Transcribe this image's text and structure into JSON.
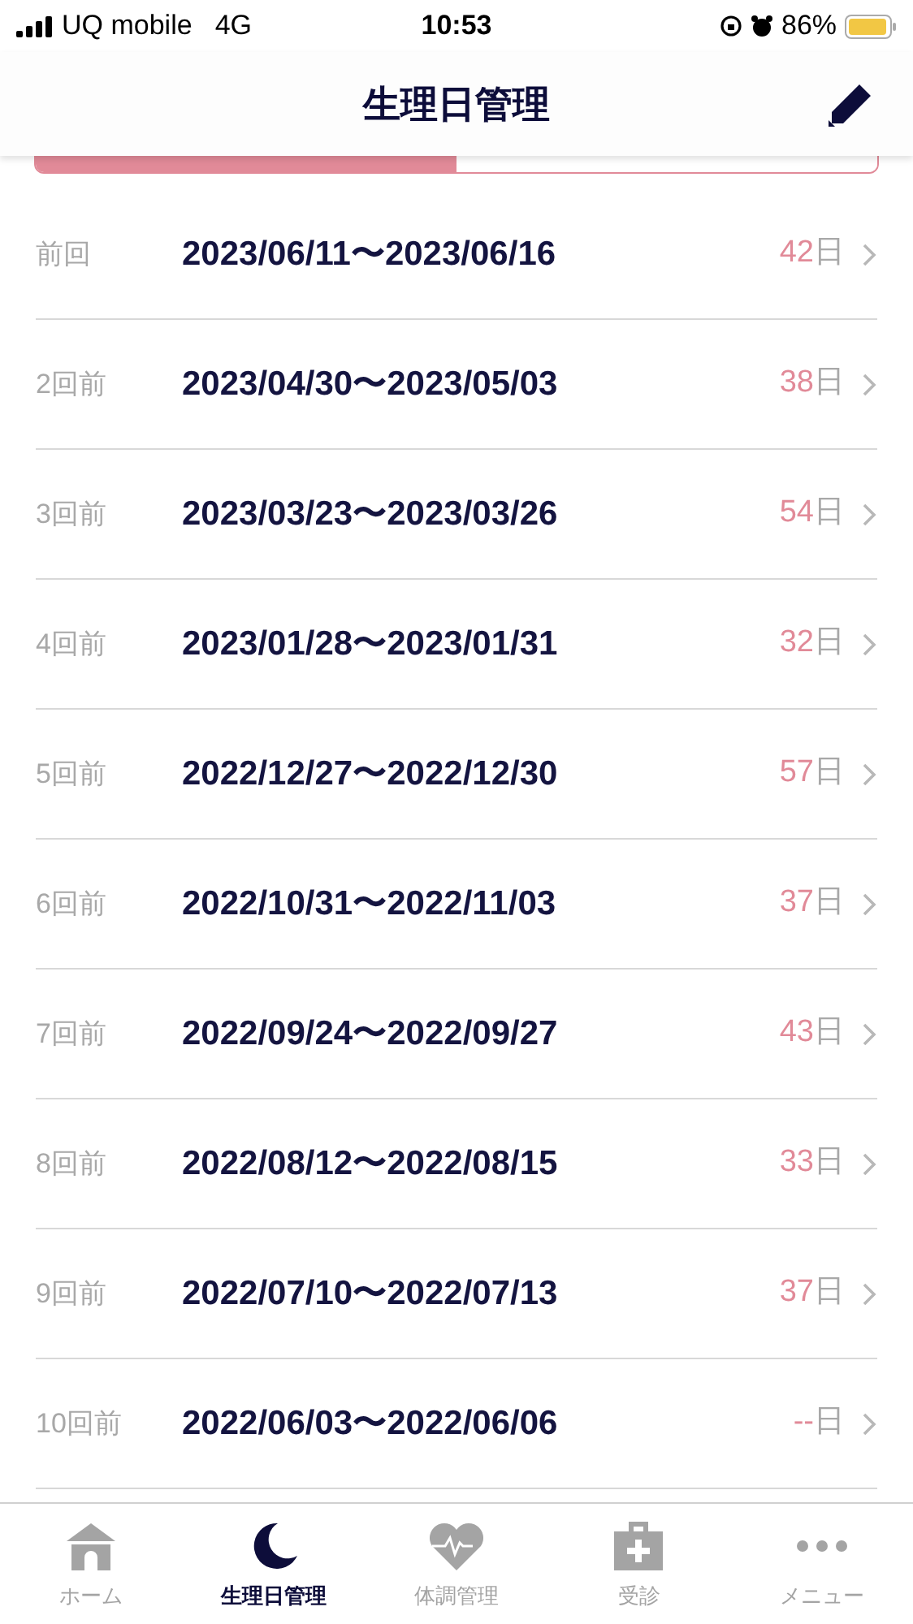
{
  "status_bar": {
    "carrier": "UQ mobile",
    "network": "4G",
    "time": "10:53",
    "battery": "86%"
  },
  "header": {
    "title": "生理日管理"
  },
  "segments": [
    {
      "selected": true
    },
    {
      "selected": false
    }
  ],
  "periods": [
    {
      "label": "前回",
      "range": "2023/06/11〜2023/06/16",
      "days": "42",
      "unit": "日"
    },
    {
      "label": "2回前",
      "range": "2023/04/30〜2023/05/03",
      "days": "38",
      "unit": "日"
    },
    {
      "label": "3回前",
      "range": "2023/03/23〜2023/03/26",
      "days": "54",
      "unit": "日"
    },
    {
      "label": "4回前",
      "range": "2023/01/28〜2023/01/31",
      "days": "32",
      "unit": "日"
    },
    {
      "label": "5回前",
      "range": "2022/12/27〜2022/12/30",
      "days": "57",
      "unit": "日"
    },
    {
      "label": "6回前",
      "range": "2022/10/31〜2022/11/03",
      "days": "37",
      "unit": "日"
    },
    {
      "label": "7回前",
      "range": "2022/09/24〜2022/09/27",
      "days": "43",
      "unit": "日"
    },
    {
      "label": "8回前",
      "range": "2022/08/12〜2022/08/15",
      "days": "33",
      "unit": "日"
    },
    {
      "label": "9回前",
      "range": "2022/07/10〜2022/07/13",
      "days": "37",
      "unit": "日"
    },
    {
      "label": "10回前",
      "range": "2022/06/03〜2022/06/06",
      "days": "--",
      "unit": "日"
    }
  ],
  "tab_bar": [
    {
      "kind": "home",
      "label": "ホーム",
      "selected": false
    },
    {
      "kind": "moon",
      "label": "生理日管理",
      "selected": true
    },
    {
      "kind": "heart",
      "label": "体調管理",
      "selected": false
    },
    {
      "kind": "clinic",
      "label": "受診",
      "selected": false
    },
    {
      "kind": "more",
      "label": "メニュー",
      "selected": false
    }
  ]
}
